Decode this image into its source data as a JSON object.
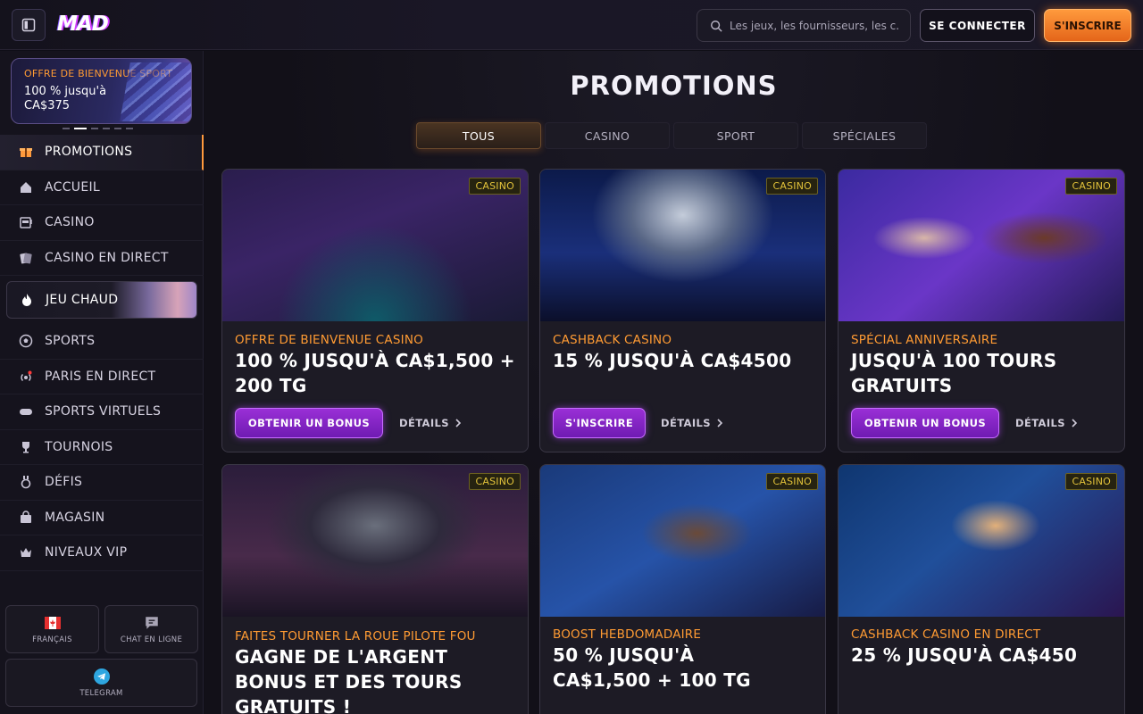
{
  "header": {
    "logo_text": "MAD",
    "search_placeholder": "Les jeux, les fournisseurs, les c...",
    "login_label": "SE CONNECTER",
    "signup_label": "S'INSCRIRE"
  },
  "sidebar": {
    "banner": {
      "kicker": "OFFRE DE BIENVENUE SPORT",
      "text": "100 % jusqu'à CA$375"
    },
    "items": [
      {
        "label": "PROMOTIONS",
        "icon": "gift-icon"
      },
      {
        "label": "ACCUEIL",
        "icon": "home-icon"
      },
      {
        "label": "CASINO",
        "icon": "slot-machine-icon"
      },
      {
        "label": "CASINO EN DIRECT",
        "icon": "cards-icon"
      },
      {
        "label": "JEU CHAUD",
        "icon": "flame-icon"
      },
      {
        "label": "SPORTS",
        "icon": "soccer-ball-icon"
      },
      {
        "label": "PARIS EN DIRECT",
        "icon": "live-broadcast-icon"
      },
      {
        "label": "SPORTS VIRTUELS",
        "icon": "gamepad-icon"
      },
      {
        "label": "TOURNOIS",
        "icon": "trophy-icon"
      },
      {
        "label": "DÉFIS",
        "icon": "medal-icon"
      },
      {
        "label": "MAGASIN",
        "icon": "shopping-bag-icon"
      },
      {
        "label": "NIVEAUX VIP",
        "icon": "crown-icon"
      }
    ],
    "language_label": "FRANÇAIS",
    "chat_label": "CHAT EN LIGNE",
    "telegram_label": "TELEGRAM"
  },
  "main": {
    "title": "PROMOTIONS",
    "tabs": [
      "TOUS",
      "CASINO",
      "SPORT",
      "SPÉCIALES"
    ],
    "cards": [
      {
        "badge": "CASINO",
        "kicker": "OFFRE DE BIENVENUE CASINO",
        "headline": "100 % JUSQU'À CA$1,500 + 200 TG",
        "cta": "OBTENIR UN BONUS",
        "details": "DÉTAILS"
      },
      {
        "badge": "CASINO",
        "kicker": "CASHBACK CASINO",
        "headline": "15 % JUSQU'À CA$4500",
        "cta": "S'INSCRIRE",
        "details": "DÉTAILS"
      },
      {
        "badge": "CASINO",
        "kicker": "SPÉCIAL ANNIVERSAIRE",
        "headline": "JUSQU'À 100 TOURS GRATUITS",
        "cta": "OBTENIR UN BONUS",
        "details": "DÉTAILS"
      },
      {
        "badge": "CASINO",
        "kicker": "FAITES TOURNER LA ROUE PILOTE FOU",
        "headline": "GAGNE DE L'ARGENT BONUS ET DES TOURS GRATUITS !"
      },
      {
        "badge": "CASINO",
        "kicker": "BOOST HEBDOMADAIRE",
        "headline": "50 % JUSQU'À CA$1,500 + 100 TG"
      },
      {
        "badge": "CASINO",
        "kicker": "CASHBACK CASINO EN DIRECT",
        "headline": "25 % JUSQU'À CA$450"
      }
    ]
  },
  "colors": {
    "accent_orange": "#ff9b33",
    "cta_purple": "#8a25c8",
    "badge_gold": "#e2c23a"
  }
}
